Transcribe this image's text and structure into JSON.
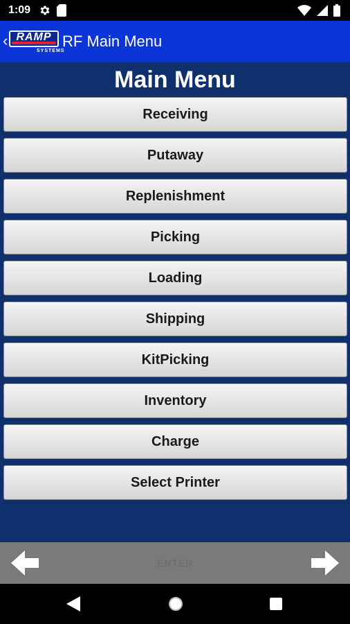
{
  "status_bar": {
    "time": "1:09",
    "left_icons": [
      "settings-gear-icon",
      "sd-card-icon"
    ],
    "right_icons": [
      "wifi-icon",
      "signal-icon",
      "battery-icon"
    ]
  },
  "header": {
    "logo_text": "RAMP",
    "logo_subtext": "SYSTEMS",
    "title": "RF Main Menu",
    "background_color": "#0b35d6"
  },
  "main": {
    "title": "Main Menu",
    "background_color": "#0f2f6d",
    "menu_items": [
      {
        "label": "Receiving"
      },
      {
        "label": "Putaway"
      },
      {
        "label": "Replenishment"
      },
      {
        "label": "Picking"
      },
      {
        "label": "Loading"
      },
      {
        "label": "Shipping"
      },
      {
        "label": "KitPicking"
      },
      {
        "label": "Inventory"
      },
      {
        "label": "Charge"
      },
      {
        "label": "Select Printer"
      }
    ]
  },
  "footer": {
    "enter_label": "ENTER",
    "prev_icon": "arrow-left-icon",
    "next_icon": "arrow-right-icon"
  },
  "nav_bar": {
    "icons": [
      "back-triangle-icon",
      "home-circle-icon",
      "recents-square-icon"
    ]
  }
}
